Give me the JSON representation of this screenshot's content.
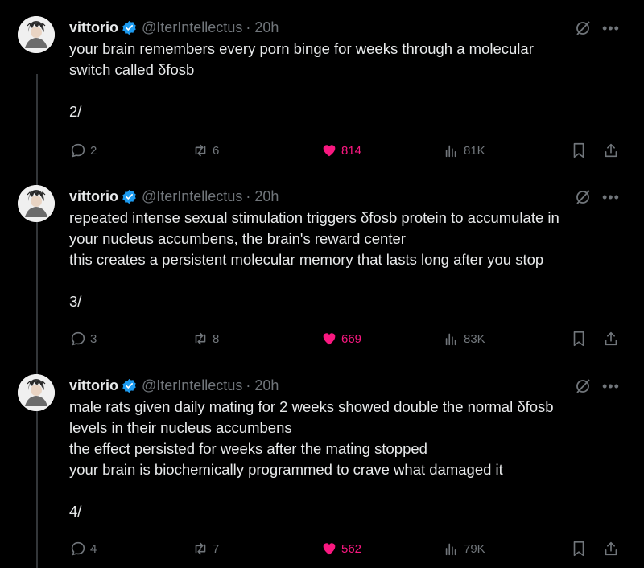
{
  "colors": {
    "background": "#000000",
    "text": "#e7e9ea",
    "muted": "#71767b",
    "like": "#f91880",
    "verified": "#1d9bf0"
  },
  "tweets": [
    {
      "name": "vittorio",
      "handle": "@IterIntellectus",
      "time": "· 20h",
      "text": "your brain remembers every porn binge for weeks through a molecular\nswitch called δfosb\n\n2/",
      "replies": "2",
      "reposts": "6",
      "likes": "814",
      "views": "81K"
    },
    {
      "name": "vittorio",
      "handle": "@IterIntellectus",
      "time": "· 20h",
      "text": "repeated intense sexual stimulation triggers δfosb protein to accumulate in\nyour nucleus accumbens, the brain's reward center\nthis creates a persistent molecular memory that lasts long after you stop\n\n3/",
      "replies": "3",
      "reposts": "8",
      "likes": "669",
      "views": "83K"
    },
    {
      "name": "vittorio",
      "handle": "@IterIntellectus",
      "time": "· 20h",
      "text": "male rats given daily mating for 2 weeks showed double the normal δfosb\nlevels in their nucleus accumbens\nthe effect persisted for weeks after the mating stopped\nyour brain is biochemically programmed to crave what damaged it\n\n4/",
      "replies": "4",
      "reposts": "7",
      "likes": "562",
      "views": "79K"
    }
  ],
  "icons": {
    "more": "more-icon",
    "grok": "grok-icon",
    "reply": "reply-icon",
    "repost": "repost-icon",
    "like": "heart-icon",
    "views": "views-icon",
    "bookmark": "bookmark-icon",
    "share": "share-icon"
  }
}
